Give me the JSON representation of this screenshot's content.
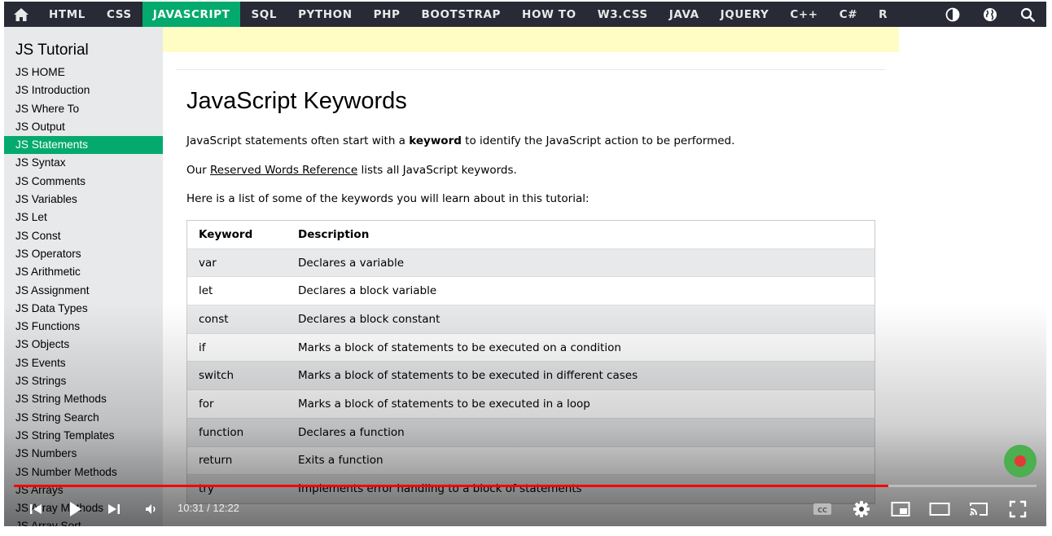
{
  "topnav": {
    "items": [
      "HTML",
      "CSS",
      "JAVASCRIPT",
      "SQL",
      "PYTHON",
      "PHP",
      "BOOTSTRAP",
      "HOW TO",
      "W3.CSS",
      "JAVA",
      "JQUERY",
      "C++",
      "C#",
      "R"
    ],
    "active": "JAVASCRIPT",
    "icons": [
      "home-icon",
      "contrast-icon",
      "globe-icon",
      "search-icon"
    ]
  },
  "sidebar": {
    "title": "JS Tutorial",
    "items": [
      "JS HOME",
      "JS Introduction",
      "JS Where To",
      "JS Output",
      "JS Statements",
      "JS Syntax",
      "JS Comments",
      "JS Variables",
      "JS Let",
      "JS Const",
      "JS Operators",
      "JS Arithmetic",
      "JS Assignment",
      "JS Data Types",
      "JS Functions",
      "JS Objects",
      "JS Events",
      "JS Strings",
      "JS String Methods",
      "JS String Search",
      "JS String Templates",
      "JS Numbers",
      "JS Number Methods",
      "JS Arrays",
      "JS Array Methods",
      "JS Array Sort"
    ],
    "active": "JS Statements"
  },
  "main": {
    "heading": "JavaScript Keywords",
    "p1_before": "JavaScript statements often start with a ",
    "p1_bold": "keyword",
    "p1_after": " to identify the JavaScript action to be performed.",
    "p2_before": "Our ",
    "p2_link": "Reserved Words Reference",
    "p2_after": " lists all JavaScript keywords.",
    "p3": "Here is a list of some of the keywords you will learn about in this tutorial:",
    "table": {
      "headers": [
        "Keyword",
        "Description"
      ],
      "rows": [
        [
          "var",
          "Declares a variable"
        ],
        [
          "let",
          "Declares a block variable"
        ],
        [
          "const",
          "Declares a block constant"
        ],
        [
          "if",
          "Marks a block of statements to be executed on a condition"
        ],
        [
          "switch",
          "Marks a block of statements to be executed in different cases"
        ],
        [
          "for",
          "Marks a block of statements to be executed in a loop"
        ],
        [
          "function",
          "Declares a function"
        ],
        [
          "return",
          "Exits a function"
        ],
        [
          "try",
          "Implements error handling to a block of statements"
        ]
      ]
    }
  },
  "player": {
    "time": "10:31 / 12:22",
    "progress_fraction": 0.855,
    "icons": [
      "previous-icon",
      "play-icon",
      "next-icon",
      "volume-icon",
      "captions-icon",
      "settings-icon",
      "miniplayer-icon",
      "theater-icon",
      "cast-icon",
      "fullscreen-icon"
    ]
  },
  "colors": {
    "nav_bg": "#282a35",
    "accent": "#04aa6d",
    "sidebar_bg": "#e7e9eb",
    "banner": "#fffdc4",
    "progress": "#ff0000"
  }
}
